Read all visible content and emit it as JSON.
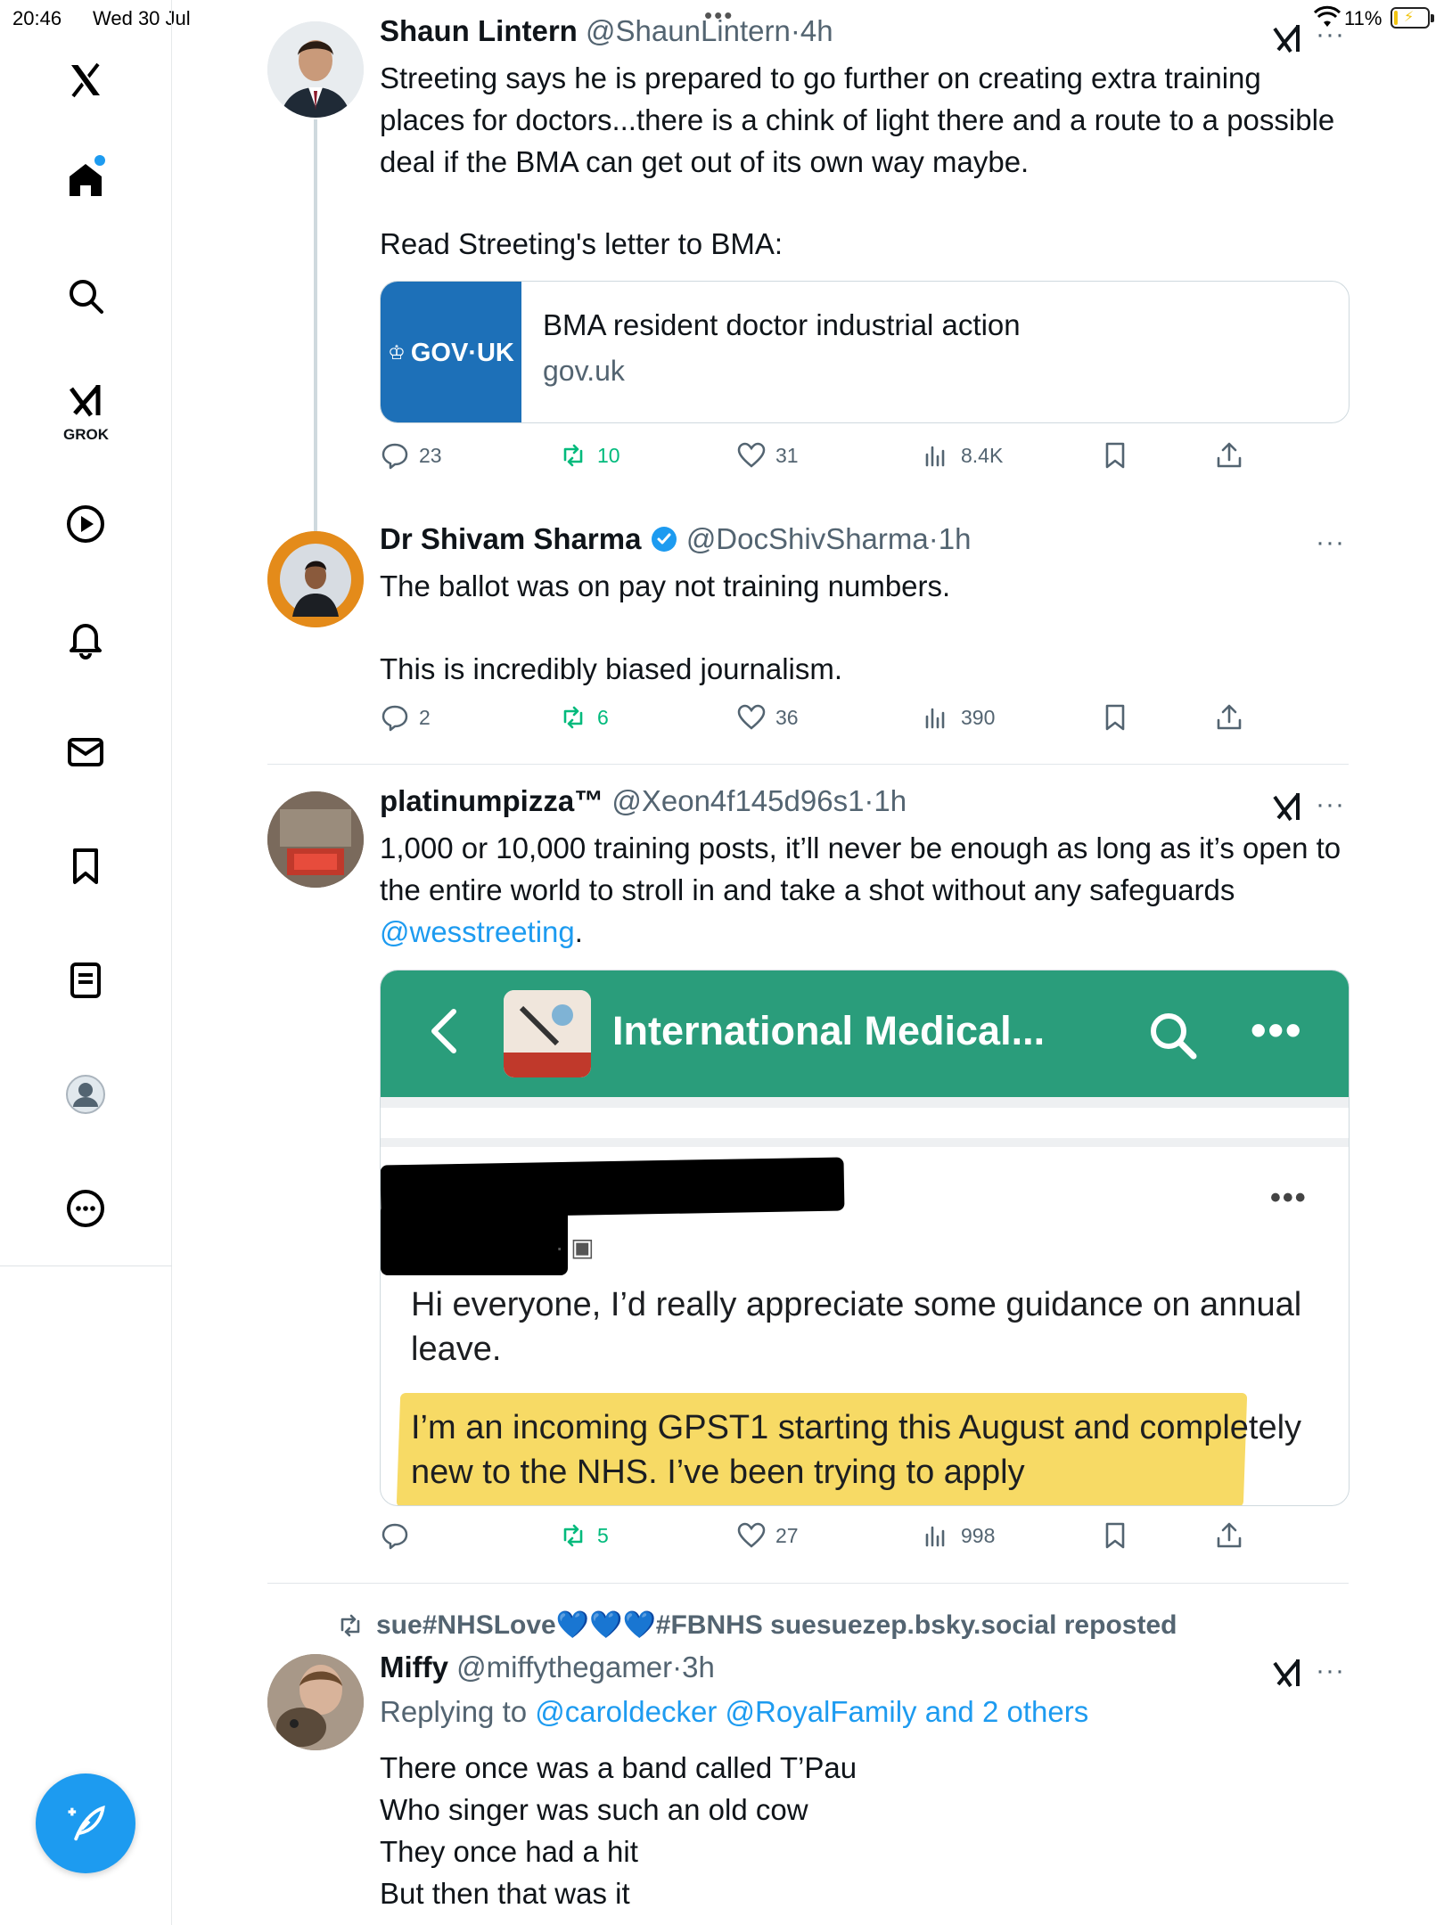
{
  "status_bar": {
    "time": "20:46",
    "date": "Wed 30 Jul",
    "battery": "11%",
    "battery_level": 0.11
  },
  "sidebar": {
    "grok_label": "GROK",
    "colors": {
      "accent": "#1d9bf0"
    }
  },
  "tweets": [
    {
      "name": "Shaun Lintern",
      "handle": "@ShaunLintern",
      "time": "4h",
      "text": "Streeting says he is prepared to go further on creating extra training places for doctors...there is a chink of light there and a route to a possible deal if the BMA can get out of its own way maybe.",
      "text2": "Read Streeting's letter to BMA:",
      "card": {
        "thumb": "GOV·UK",
        "title": "BMA resident doctor industrial action",
        "domain": "gov.uk"
      },
      "replies": "23",
      "reposts": "10",
      "likes": "31",
      "views": "8.4K"
    },
    {
      "name": "Dr Shivam Sharma",
      "handle": "@DocShivSharma",
      "time": "1h",
      "text": "The ballot was on pay not training numbers.",
      "text2": "This is incredibly biased journalism.",
      "replies": "2",
      "reposts": "6",
      "likes": "36",
      "views": "390"
    },
    {
      "name": "platinumpizza™",
      "handle": "@Xeon4f145d96s1",
      "time": "1h",
      "text": "1,000 or 10,000 training posts, it’ll never be enough as long as it’s open to the entire world to stroll in and take a shot without any safeguards",
      "mention": "@wesstreeting",
      "image": {
        "app_title": "International Medical...",
        "post_line1": "Hi everyone, I’d really appreciate some guidance on annual leave.",
        "post_line2": "I’m an incoming GPST1 starting this August and completely new to the NHS. I’ve been trying to apply"
      },
      "replies": "",
      "reposts": "5",
      "likes": "27",
      "views": "998"
    },
    {
      "repost_by": "sue#NHSLove💙💙💙#FBNHS suesuezep.bsky.social reposted",
      "name": "Miffy",
      "handle": "@miffythegamer",
      "time": "3h",
      "replying_prefix": "Replying to",
      "replying_to": "@caroldecker @RoyalFamily and 2 others",
      "lines": [
        "There once was a band called T’Pau",
        "Who singer was such an old cow",
        "They once had a hit",
        "But then that was it"
      ]
    }
  ]
}
